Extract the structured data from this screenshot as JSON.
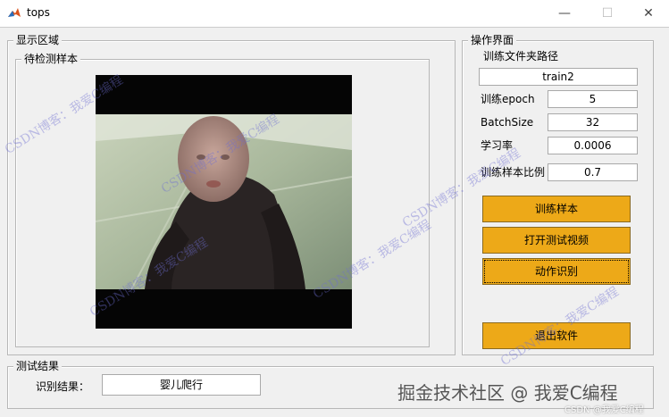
{
  "window": {
    "title": "tops",
    "min_glyph": "—",
    "max_glyph": "☐",
    "close_glyph": "✕"
  },
  "display": {
    "title": "显示区域",
    "sample_title": "待检测样本"
  },
  "operation": {
    "title": "操作界面",
    "folder_label": "训练文件夹路径",
    "folder_value": "train2",
    "params": [
      {
        "label": "训练epoch",
        "value": "5"
      },
      {
        "label": "BatchSize",
        "value": "32"
      },
      {
        "label": "学习率",
        "value": "0.0006"
      },
      {
        "label": "训练样本比例",
        "value": "0.7"
      }
    ],
    "buttons": {
      "train": "训练样本",
      "open_video": "打开测试视频",
      "recognize": "动作识别",
      "exit": "退出软件"
    }
  },
  "result": {
    "title": "测试结果",
    "label": "识别结果：",
    "value": "婴儿爬行"
  },
  "watermarks": {
    "blog": "CSDN博客：我爱C编程",
    "brand": "掘金技术社区 @ 我爱C编程",
    "brand_small": "CSDN @我爱C编程"
  },
  "colors": {
    "button": "#eda918",
    "background": "#f0f0f0"
  }
}
